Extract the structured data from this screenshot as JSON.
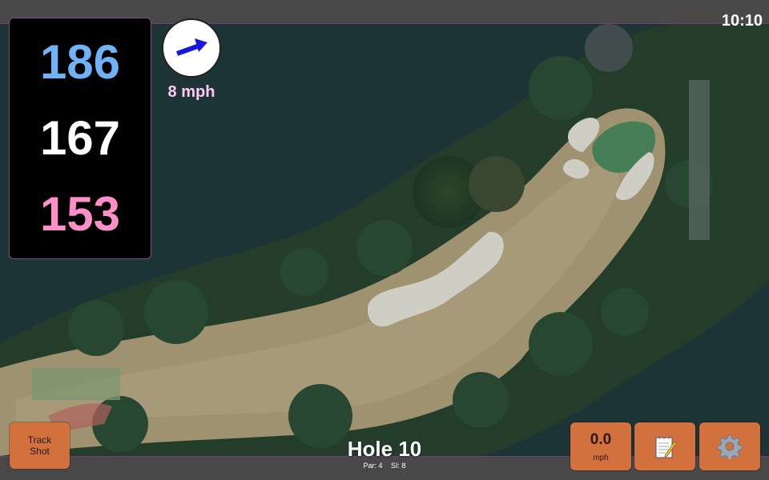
{
  "status_bar": {
    "time": "10:10"
  },
  "distances": {
    "back": "186",
    "center": "167",
    "front": "153",
    "colors": {
      "back": "#6fb2f5",
      "center": "#ffffff",
      "front": "#ff8fc8"
    }
  },
  "wind": {
    "speed": "8 mph",
    "icon": "wind-arrow-icon",
    "arrow_color": "#1818dd"
  },
  "hole": {
    "title": "Hole 10",
    "par": "Par: 4",
    "si": "SI: 8"
  },
  "buttons": {
    "track_shot": {
      "line1": "Track",
      "line2": "Shot"
    },
    "speed": {
      "value": "0.0",
      "unit": "mph"
    },
    "notes": {
      "icon": "notepad-icon"
    },
    "settings": {
      "icon": "gear-icon"
    }
  },
  "theme": {
    "button_color": "#d2703e",
    "bar_color": "#484848",
    "border_accent": "#7a3a78"
  }
}
